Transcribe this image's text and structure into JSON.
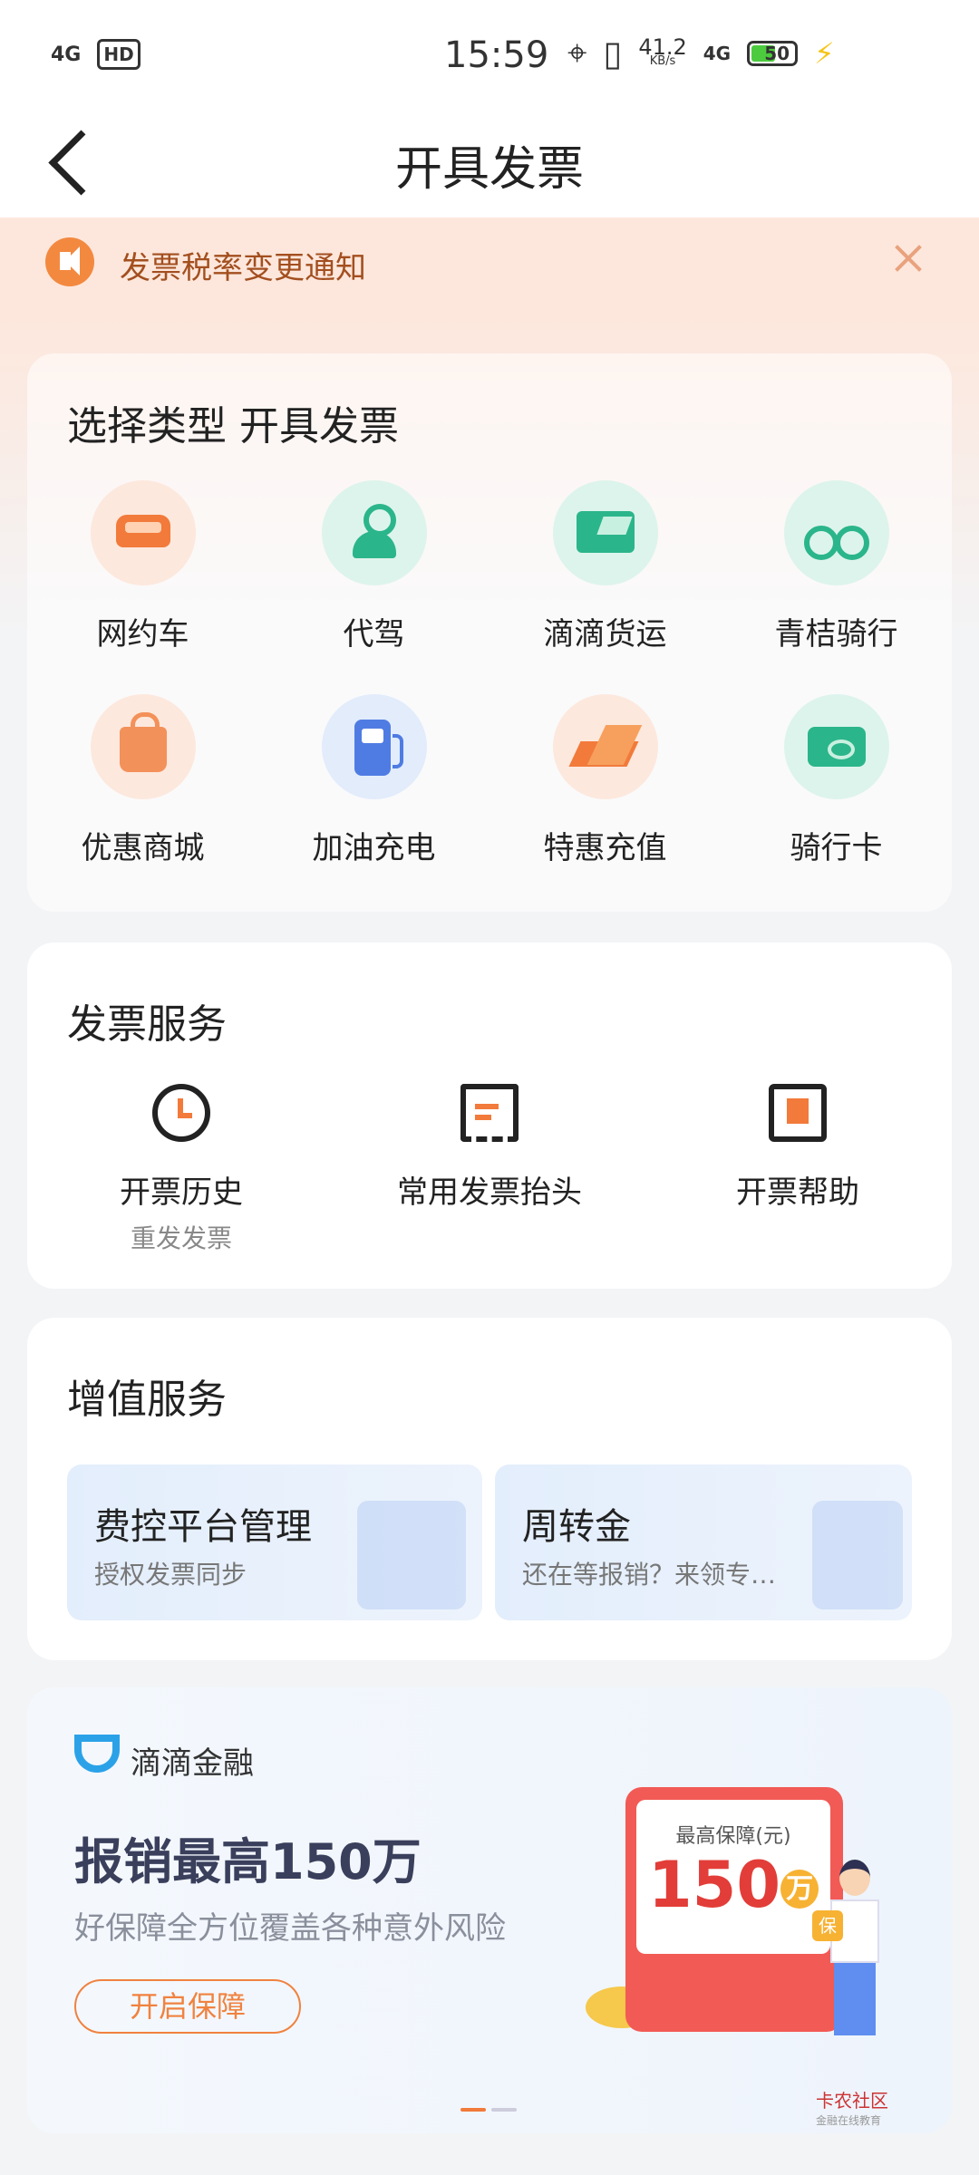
{
  "status_bar": {
    "network": "4G",
    "hd": "HD",
    "time": "15:59",
    "speed": "41.2",
    "speed_unit": "KB/s",
    "network2": "4G",
    "battery": "50"
  },
  "nav": {
    "title": "开具发票"
  },
  "notice": {
    "text": "发票税率变更通知"
  },
  "types": {
    "title": "选择类型 开具发票",
    "items": [
      {
        "label": "网约车",
        "icon": "car-icon",
        "color": "#f27a3a"
      },
      {
        "label": "代驾",
        "icon": "driver-icon",
        "color": "#2bb58a"
      },
      {
        "label": "滴滴货运",
        "icon": "truck-icon",
        "color": "#2bb58a"
      },
      {
        "label": "青桔骑行",
        "icon": "bike-icon",
        "color": "#2bb58a"
      },
      {
        "label": "优惠商城",
        "icon": "shopping-bag-icon",
        "color": "#f3915a"
      },
      {
        "label": "加油充电",
        "icon": "fuel-pump-icon",
        "color": "#4f7ce3"
      },
      {
        "label": "特惠充值",
        "icon": "top-up-icon",
        "color": "#f27a3a"
      },
      {
        "label": "骑行卡",
        "icon": "ticket-icon",
        "color": "#2bb58a"
      }
    ]
  },
  "invoice_service": {
    "title": "发票服务",
    "items": [
      {
        "label": "开票历史",
        "sub": "重发发票",
        "icon": "clock-icon"
      },
      {
        "label": "常用发票抬头",
        "sub": "",
        "icon": "receipt-icon"
      },
      {
        "label": "开票帮助",
        "sub": "",
        "icon": "help-book-icon"
      }
    ]
  },
  "value_added": {
    "title": "增值服务",
    "tiles": [
      {
        "title": "费控平台管理",
        "sub": "授权发票同步"
      },
      {
        "title": "周转金",
        "sub": "还在等报销？来领专…"
      }
    ]
  },
  "finance": {
    "brand": "滴滴金融",
    "headline": "报销最高150万",
    "sub": "好保障全方位覆盖各种意外风险",
    "button": "开启保障",
    "card_caption": "最高保障(元)",
    "card_amount": "150",
    "card_unit": "万",
    "badge": "保",
    "watermark": "卡农社区",
    "watermark_sub": "金融在线教育",
    "accent": "#f0823f"
  }
}
